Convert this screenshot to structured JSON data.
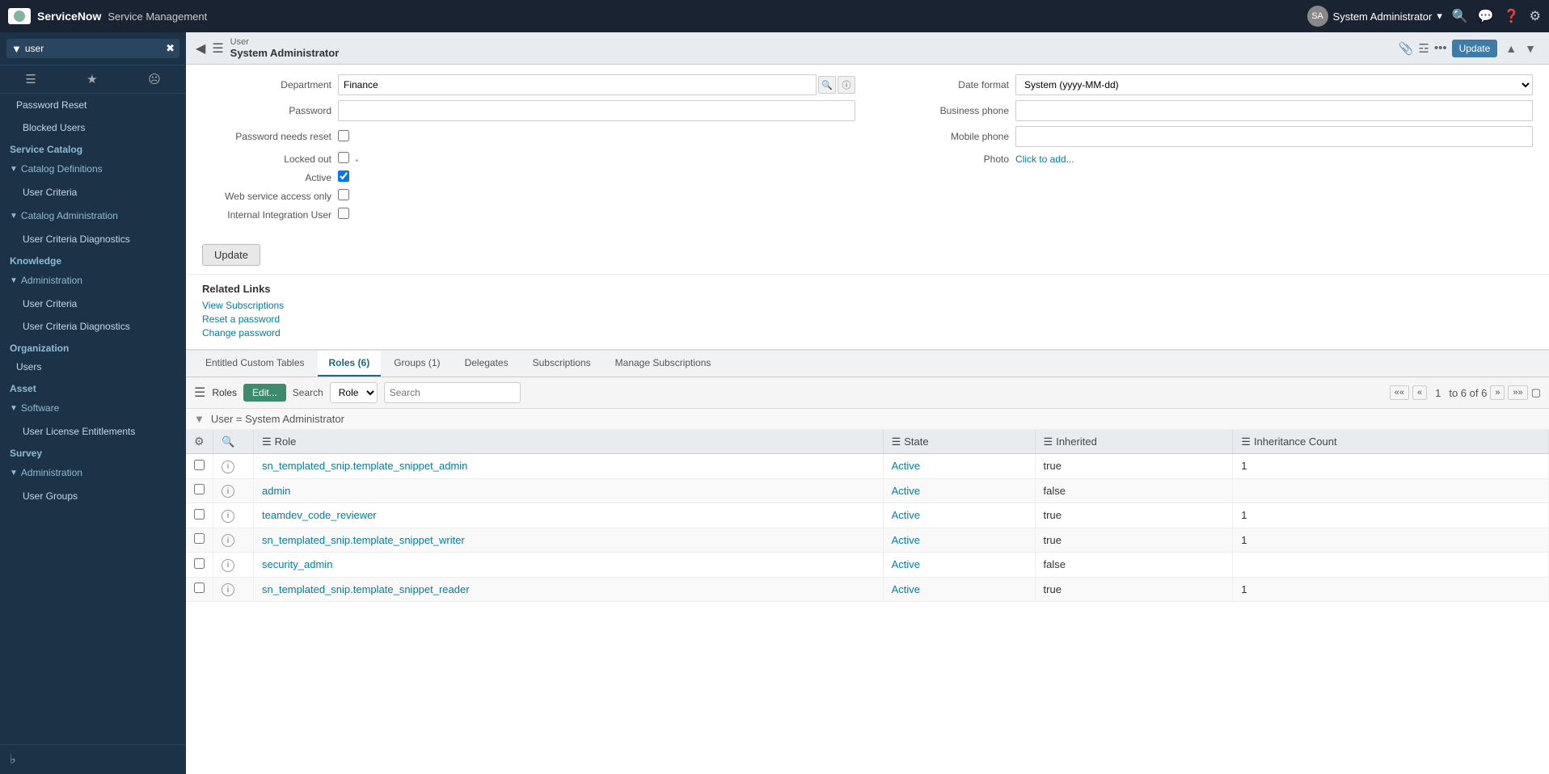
{
  "app": {
    "name": "ServiceNow",
    "module": "Service Management"
  },
  "topnav": {
    "user": "System Administrator",
    "icons": [
      "search",
      "chat",
      "help",
      "settings"
    ]
  },
  "sidebar": {
    "search_placeholder": "user",
    "sections": [
      {
        "type": "item",
        "label": "Password Reset",
        "level": 0
      },
      {
        "type": "item",
        "label": "Blocked Users",
        "level": 1
      },
      {
        "type": "header",
        "label": "Service Catalog",
        "level": 0
      },
      {
        "type": "group",
        "label": "▼ Catalog Definitions",
        "level": 0
      },
      {
        "type": "item",
        "label": "User Criteria",
        "level": 1
      },
      {
        "type": "group",
        "label": "▼ Catalog Administration",
        "level": 0
      },
      {
        "type": "item",
        "label": "User Criteria Diagnostics",
        "level": 1
      },
      {
        "type": "header",
        "label": "Knowledge",
        "level": 0
      },
      {
        "type": "group",
        "label": "▼ Administration",
        "level": 0
      },
      {
        "type": "item",
        "label": "User Criteria",
        "level": 1
      },
      {
        "type": "item",
        "label": "User Criteria Diagnostics",
        "level": 1
      },
      {
        "type": "header",
        "label": "Organization",
        "level": 0
      },
      {
        "type": "item",
        "label": "Users",
        "level": 0
      },
      {
        "type": "header",
        "label": "Asset",
        "level": 0
      },
      {
        "type": "group",
        "label": "▼ Software",
        "level": 0
      },
      {
        "type": "item",
        "label": "User License Entitlements",
        "level": 1
      },
      {
        "type": "header",
        "label": "Survey",
        "level": 0
      },
      {
        "type": "group",
        "label": "▼ Administration",
        "level": 0
      },
      {
        "type": "item",
        "label": "User Groups",
        "level": 1
      }
    ]
  },
  "record": {
    "type": "User",
    "name": "System Administrator"
  },
  "form": {
    "fields_left": [
      {
        "label": "Department",
        "type": "ref",
        "value": "Finance"
      },
      {
        "label": "Password",
        "type": "password",
        "value": ""
      },
      {
        "label": "Password needs reset",
        "type": "checkbox",
        "checked": false
      },
      {
        "label": "Locked out",
        "type": "checkbox",
        "checked": false
      },
      {
        "label": "Active",
        "type": "checkbox",
        "checked": true
      },
      {
        "label": "Web service access only",
        "type": "checkbox",
        "checked": false
      },
      {
        "label": "Internal Integration User",
        "type": "checkbox",
        "checked": false
      }
    ],
    "fields_right": [
      {
        "label": "Date format",
        "type": "select",
        "value": "System (yyyy-MM-dd)"
      },
      {
        "label": "Business phone",
        "type": "text",
        "value": ""
      },
      {
        "label": "Mobile phone",
        "type": "text",
        "value": ""
      },
      {
        "label": "Photo",
        "type": "link",
        "value": "Click to add..."
      }
    ]
  },
  "related_links": {
    "title": "Related Links",
    "links": [
      "View Subscriptions",
      "Reset a password",
      "Change password"
    ]
  },
  "tabs": {
    "items": [
      {
        "label": "Entitled Custom Tables",
        "active": false
      },
      {
        "label": "Roles (6)",
        "active": true
      },
      {
        "label": "Groups (1)",
        "active": false
      },
      {
        "label": "Delegates",
        "active": false
      },
      {
        "label": "Subscriptions",
        "active": false
      },
      {
        "label": "Manage Subscriptions",
        "active": false
      }
    ]
  },
  "roles_table": {
    "toolbar": {
      "menu_label": "≡",
      "list_label": "Roles",
      "edit_label": "Edit...",
      "search_label": "Search",
      "search_field": "Role",
      "search_placeholder": "Search"
    },
    "pagination": {
      "first": "«",
      "prev": "‹",
      "current": "1",
      "of": "to 6 of 6",
      "next": "›",
      "last": "»"
    },
    "filter": "User = System Administrator",
    "columns": [
      {
        "label": "Role"
      },
      {
        "label": "State"
      },
      {
        "label": "Inherited"
      },
      {
        "label": "Inheritance Count"
      }
    ],
    "rows": [
      {
        "role": "sn_templated_snip.template_snippet_admin",
        "state": "Active",
        "inherited": "true",
        "count": "1"
      },
      {
        "role": "admin",
        "state": "Active",
        "inherited": "false",
        "count": ""
      },
      {
        "role": "teamdev_code_reviewer",
        "state": "Active",
        "inherited": "true",
        "count": "1"
      },
      {
        "role": "sn_templated_snip.template_snippet_writer",
        "state": "Active",
        "inherited": "true",
        "count": "1"
      },
      {
        "role": "security_admin",
        "state": "Active",
        "inherited": "false",
        "count": ""
      },
      {
        "role": "sn_templated_snip.template_snippet_reader",
        "state": "Active",
        "inherited": "true",
        "count": "1"
      }
    ]
  },
  "buttons": {
    "update": "Update",
    "form_update": "Update"
  },
  "colors": {
    "sidebar_bg": "#1c3246",
    "header_bg": "#1a2332",
    "accent": "#0080a0",
    "tab_active": "#1a6a8a",
    "edit_btn": "#3d8a6e"
  }
}
